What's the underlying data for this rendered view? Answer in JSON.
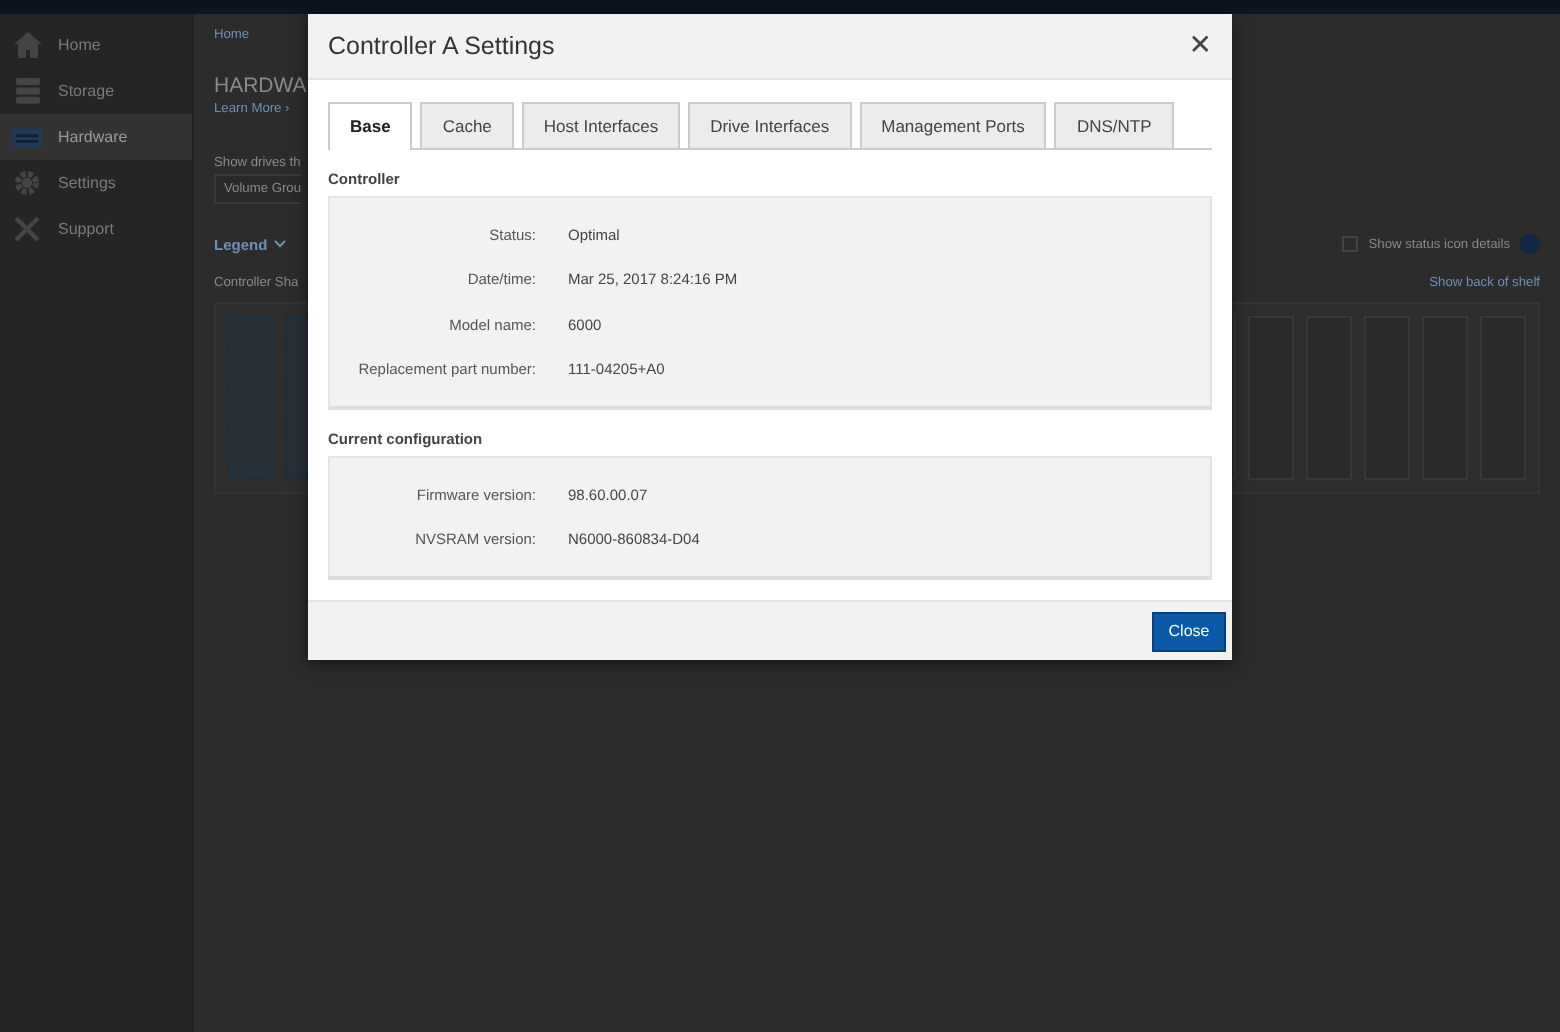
{
  "sidebar": {
    "items": [
      {
        "label": "Home",
        "selected": false
      },
      {
        "label": "Storage",
        "selected": false
      },
      {
        "label": "Hardware",
        "selected": true
      },
      {
        "label": "Settings",
        "selected": false
      },
      {
        "label": "Support",
        "selected": false
      }
    ]
  },
  "page": {
    "breadcrumb": "Home",
    "heading": "HARDWA",
    "learn_more": "Learn More ›",
    "filter_label": "Show drives th",
    "filter_value": "Volume Grou",
    "legend": "Legend",
    "shelf_title": "Controller Sha",
    "status_details": {
      "label": "Show status icon details",
      "checked": false
    },
    "back_of_shelf": "Show back of shelf"
  },
  "dialog": {
    "title": "Controller A Settings",
    "close_icon": "✕",
    "tabs": [
      {
        "label": "Base",
        "selected": true
      },
      {
        "label": "Cache",
        "selected": false
      },
      {
        "label": "Host Interfaces",
        "selected": false
      },
      {
        "label": "Drive Interfaces",
        "selected": false
      },
      {
        "label": "Management Ports",
        "selected": false
      },
      {
        "label": "DNS/NTP",
        "selected": false
      }
    ],
    "sections": [
      {
        "title": "Controller",
        "rows": [
          {
            "label": "Status:",
            "value": "Optimal"
          },
          {
            "label": "Date/time:",
            "value": "Mar 25, 2017 8:24:16 PM"
          },
          {
            "label": "Model name:",
            "value": "6000"
          },
          {
            "label": "Replacement part number:",
            "value": "111-04205+A0"
          }
        ]
      },
      {
        "title": "Current configuration",
        "rows": [
          {
            "label": "Firmware version:",
            "value": "98.60.00.07"
          },
          {
            "label": "NVSRAM version:",
            "value": "N6000-860834-D04"
          }
        ]
      }
    ],
    "button": "Close"
  }
}
